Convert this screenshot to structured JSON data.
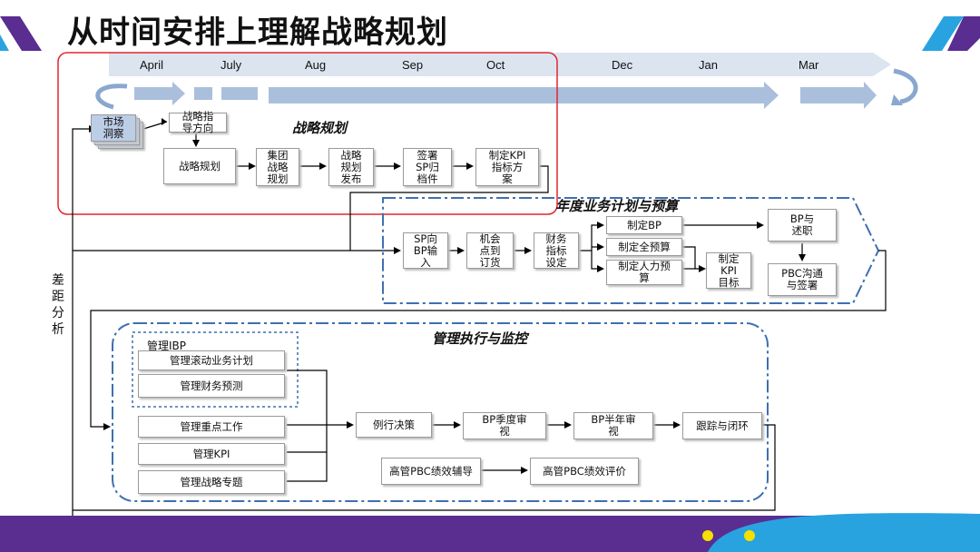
{
  "title": "从时间安排上理解战略规划",
  "months": [
    "April",
    "July",
    "Aug",
    "Sep",
    "Oct",
    "Dec",
    "Jan",
    "Mar"
  ],
  "sections": {
    "strategy": "战略规划",
    "annual": "年度业务计划与预算",
    "execution": "管理执行与监控"
  },
  "gap_label": "差\n距\n分\n析",
  "boxes": {
    "market": "市场\n洞察",
    "guide": "战略指\n导方向",
    "plan": "战略规划",
    "group": "集团\n战略\n规划",
    "release": "战略\n规划\n发布",
    "sign": "签署\nSP归\n档件",
    "kpi_plan": "制定KPI\n指标方\n案",
    "sp_bp": "SP向\nBP输\n入",
    "opp": "机会\n点到\n订货",
    "finance": "财务\n指标\n设定",
    "make_bp": "制定BP",
    "full_budget": "制定全预算",
    "hr_budget": "制定人力预\n算",
    "kpi_target": "制定\nKPI\n目标",
    "bp_report": "BP与\n述职",
    "pbc_sign": "PBC沟通\n与签署",
    "ibp": "管理IBP",
    "rolling": "管理滚动业务计划",
    "fin_forecast": "管理财务预测",
    "key_work": "管理重点工作",
    "mgmt_kpi": "管理KPI",
    "topic": "管理战略专题",
    "routine": "例行决策",
    "bp_q": "BP季度审\n视",
    "bp_h": "BP半年审\n视",
    "track": "跟踪与闭环",
    "pbc_coach": "高管PBC绩效辅导",
    "pbc_eval": "高管PBC绩效评价"
  },
  "colors": {
    "accent_purple": "#5a2d91",
    "accent_blue": "#29a3e0",
    "timeline": "#dce4f0",
    "arrow_fill": "#aabfdc",
    "dash_border": "#3e6fb0",
    "red_frame": "#e0262e",
    "dot_yellow": "#f5e000"
  }
}
